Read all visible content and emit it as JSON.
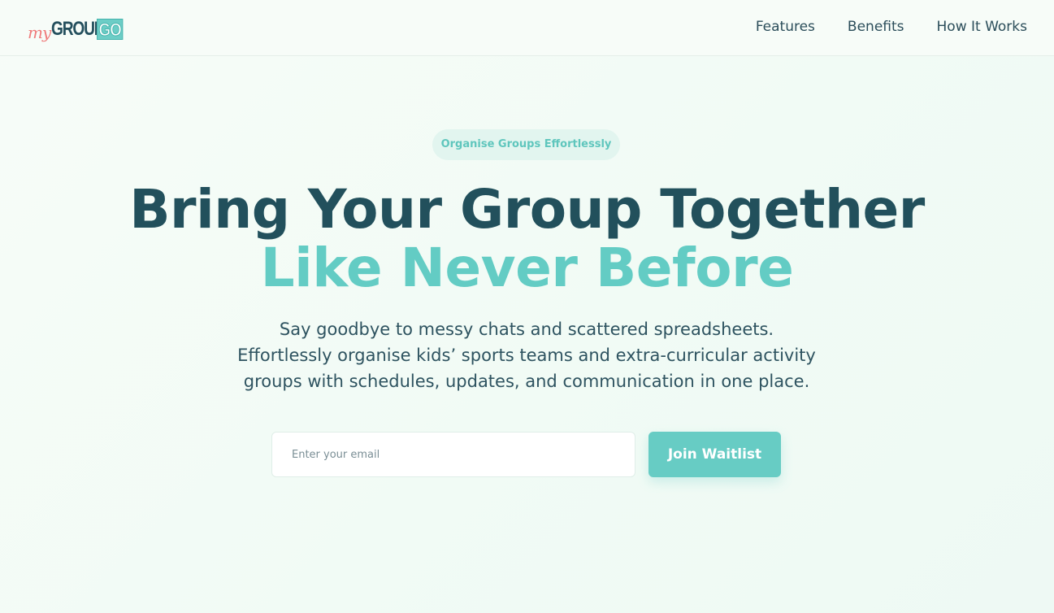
{
  "brand": {
    "logo_my": "my",
    "logo_group": "GROUP",
    "logo_go": "GO"
  },
  "nav": {
    "items": [
      {
        "label": "Features"
      },
      {
        "label": "Benefits"
      },
      {
        "label": "How It Works"
      }
    ]
  },
  "hero": {
    "badge": "Organise Groups Effortlessly",
    "headline_line1": "Bring Your Group Together",
    "headline_line2": "Like Never Before",
    "subtitle_line1": "Say goodbye to messy chats and scattered spreadsheets.",
    "subtitle_line2": "Effortlessly organise kids’ sports teams and extra-curricular activity",
    "subtitle_line3": "groups with schedules, updates, and communication in one place."
  },
  "waitlist": {
    "email_placeholder": "Enter your email",
    "email_value": "",
    "button_label": "Join Waitlist"
  },
  "colors": {
    "background": "#f5fbf7",
    "primary_dark": "#22505c",
    "accent_teal": "#63ccc4",
    "logo_coral": "#ef7b7b",
    "badge_bg": "#e2f5ef"
  }
}
